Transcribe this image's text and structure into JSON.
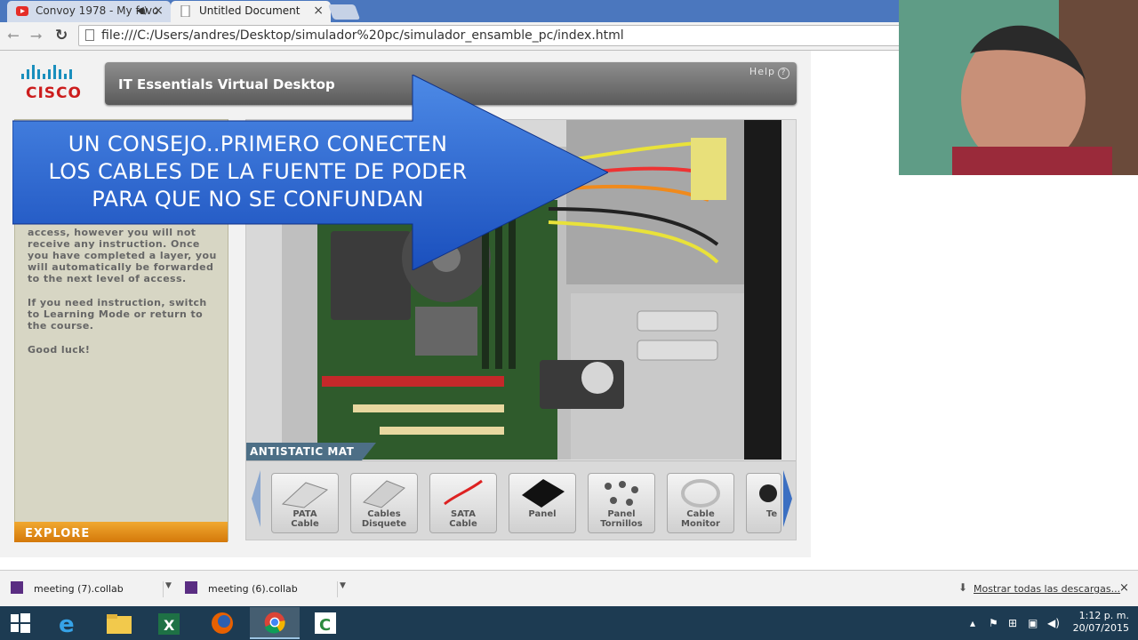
{
  "browser": {
    "tabs": [
      {
        "title": "Convoy 1978 - My favo",
        "state": "inactive",
        "icon": "youtube-icon",
        "audio_icon": "speaker-icon"
      },
      {
        "title": "Untitled Document",
        "state": "active",
        "icon": "page-icon"
      }
    ],
    "close_glyph": "×",
    "url": "file:///C:/Users/andres/Desktop/simulador%20pc/simulador_ensamble_pc/index.html"
  },
  "app": {
    "logo_text": "CISCO",
    "title": "IT Essentials Virtual Desktop",
    "help_label": "Help",
    "left_panel": {
      "paragraphs": [
        "access, however you will not receive any instruction. Once you have completed a layer, you will automatically be forwarded to the next level of access.",
        "If you need instruction, switch to Learning Mode or return to the course.",
        "Good luck!"
      ],
      "explore_label": "EXPLORE"
    },
    "viewer": {
      "mat_label": "ANTISTATIC MAT",
      "items": [
        {
          "label": "PATA\nCable",
          "icon": "ribbon-cable-icon"
        },
        {
          "label": "Cables\nDisquete",
          "icon": "floppy-cable-icon"
        },
        {
          "label": "SATA\nCable",
          "icon": "sata-cable-icon"
        },
        {
          "label": "Panel",
          "icon": "panel-icon"
        },
        {
          "label": "Panel\nTornillos",
          "icon": "screws-icon"
        },
        {
          "label": "Cable\nMonitor",
          "icon": "monitor-cable-icon"
        },
        {
          "label": "Te",
          "icon": "partial-item-icon"
        }
      ]
    }
  },
  "overlay": {
    "lines": [
      "UN CONSEJO..PRIMERO CONECTEN",
      "LOS CABLES DE LA FUENTE DE PODER",
      "PARA QUE NO SE CONFUNDAN"
    ]
  },
  "downloads": {
    "items": [
      {
        "name": "meeting (7).collab"
      },
      {
        "name": "meeting (6).collab"
      }
    ],
    "show_all": "Mostrar todas las descargas...",
    "close_glyph": "×"
  },
  "taskbar": {
    "apps": [
      "windows-start-icon",
      "internet-explorer-icon",
      "file-explorer-icon",
      "excel-icon",
      "firefox-icon",
      "chrome-icon",
      "camtasia-icon"
    ],
    "time": "1:12 p. m.",
    "date": "20/07/2015"
  },
  "colors": {
    "chrome_tabstrip": "#4b77be",
    "overlay_blue": "#1f5fc8",
    "explore_orange": "#e08a16",
    "taskbar": "#1d3b52"
  }
}
